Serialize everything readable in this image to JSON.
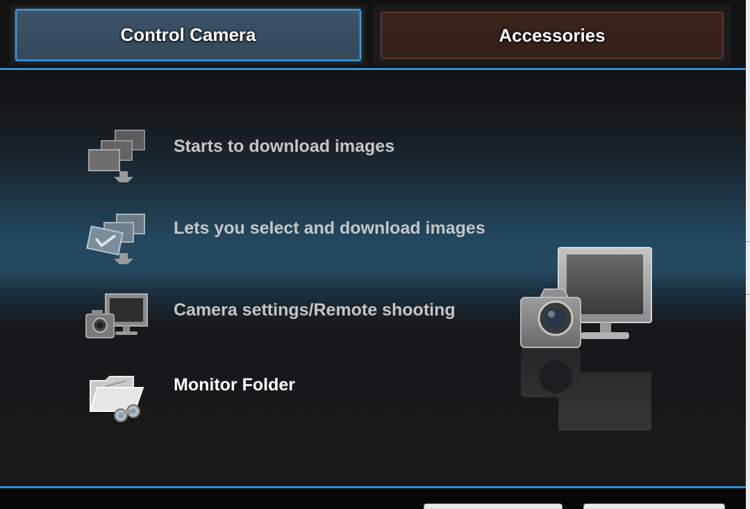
{
  "tabs": [
    {
      "label": "Control Camera",
      "active": true,
      "accent": "#3f9bdd"
    },
    {
      "label": "Accessories",
      "active": false,
      "accent": "#5a3a2e"
    }
  ],
  "menu": {
    "items": [
      {
        "label": "Starts to download images",
        "icon": "download-images-icon"
      },
      {
        "label": "Lets you select and download images",
        "icon": "select-download-icon"
      },
      {
        "label": "Camera settings/Remote shooting",
        "icon": "camera-computer-icon"
      },
      {
        "label": "Monitor Folder",
        "icon": "monitor-folder-icon"
      }
    ]
  },
  "colors": {
    "panel_border": "#2f8fd3",
    "label_text": "#c5c5c5",
    "active_label_text": "#ffffff"
  }
}
